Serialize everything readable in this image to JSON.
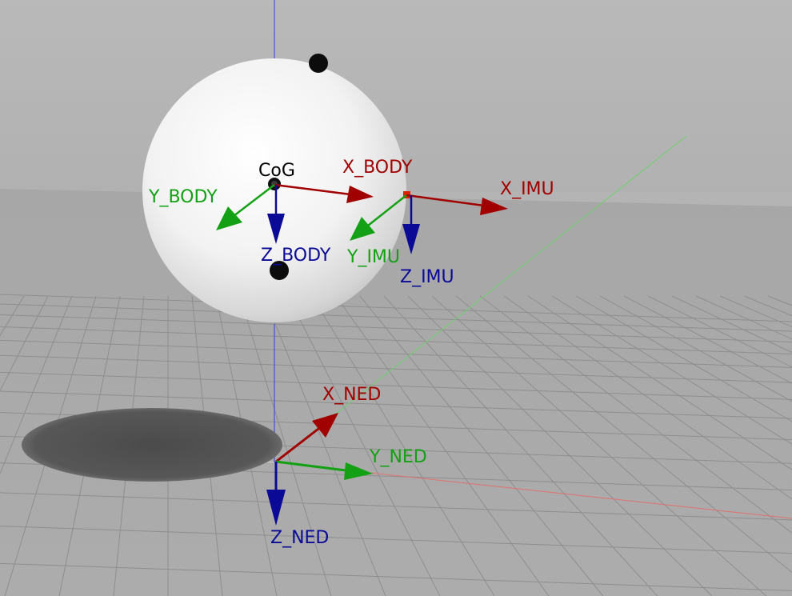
{
  "colors": {
    "x_axis": "#a00000",
    "y_axis": "#14a014",
    "z_axis": "#0a0a96",
    "label_black": "#000000",
    "sky": "#b6b6b6",
    "ground": "#a8a8a8"
  },
  "labels": {
    "cog": "CoG",
    "x_body": "X_BODY",
    "y_body": "Y_BODY",
    "z_body": "Z_BODY",
    "x_imu": "X_IMU",
    "y_imu": "Y_IMU",
    "z_imu": "Z_IMU",
    "x_ned": "X_NED",
    "y_ned": "Y_NED",
    "z_ned": "Z_NED"
  }
}
